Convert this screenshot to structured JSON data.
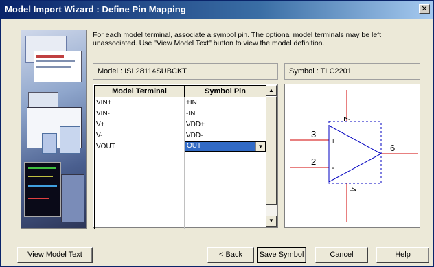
{
  "window": {
    "title": "Model Import Wizard : Define Pin Mapping",
    "close_glyph": "✕"
  },
  "instructions": "For each model terminal, associate a symbol pin. The optional model terminals may be left unassociated. Use \"View Model Text\" button to view the model definition.",
  "model": {
    "header": "Model : ISL28114SUBCKT",
    "columns": [
      "Model Terminal",
      "Symbol Pin"
    ],
    "rows": [
      {
        "terminal": "VIN+",
        "pin": "+IN"
      },
      {
        "terminal": "VIN-",
        "pin": "-IN"
      },
      {
        "terminal": "V+",
        "pin": "VDD+"
      },
      {
        "terminal": "V-",
        "pin": "VDD-"
      },
      {
        "terminal": "VOUT",
        "pin": "OUT",
        "selected": true
      }
    ],
    "empty_rows": 7
  },
  "symbol": {
    "header": "Symbol : TLC2201",
    "pins": {
      "in_plus_number": "3",
      "in_minus_number": "2",
      "out_number": "6",
      "top_number": "7",
      "bottom_number": "4",
      "plus_sign": "+",
      "minus_sign": "-"
    },
    "pin_color": "#d00000",
    "body_color": "#0000c0"
  },
  "buttons": {
    "view_model_text": "View Model Text",
    "back": "< Back",
    "save_symbol": "Save Symbol",
    "cancel": "Cancel",
    "help": "Help"
  },
  "icons": {
    "scroll_up": "▲",
    "scroll_down": "▼",
    "dropdown": "▼"
  }
}
